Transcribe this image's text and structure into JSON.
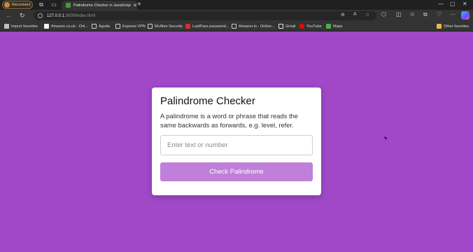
{
  "browser": {
    "reconnect_label": "Reconnect",
    "tab_title": "Palindrome Checker in JavaScript",
    "address_host": "127.0.0.1",
    "address_path": ":3000/index.html"
  },
  "bookmarks": {
    "items": [
      {
        "label": "Import favorites",
        "icon_color": "#bdbdbd"
      },
      {
        "label": "Amazon.co.uk - Onl...",
        "icon_color": "#f2f2f2"
      },
      {
        "label": "Agoda",
        "icon_color": "#cfcfcf"
      },
      {
        "label": "Express VPN",
        "icon_color": "#cfcfcf"
      },
      {
        "label": "McAfee Security",
        "icon_color": "#cfcfcf"
      },
      {
        "label": "LastPass password...",
        "icon_color": "#d32f2f"
      },
      {
        "label": "Amazon.in - Online...",
        "icon_color": "#cfcfcf"
      },
      {
        "label": "Gmail",
        "icon_color": "#e8e8e8"
      },
      {
        "label": "YouTube",
        "icon_color": "#ff0000"
      },
      {
        "label": "Maps",
        "icon_color": "#4caf50"
      }
    ],
    "other": "Other favorites"
  },
  "app": {
    "title": "Palindrome Checker",
    "description": "A palindrome is a word or phrase that reads the same backwards as forwards, e.g. level, refer.",
    "input_placeholder": "Enter text or number",
    "button_label": "Check Palindrome",
    "background_color": "#a048c8",
    "button_color": "#c07fd8"
  }
}
